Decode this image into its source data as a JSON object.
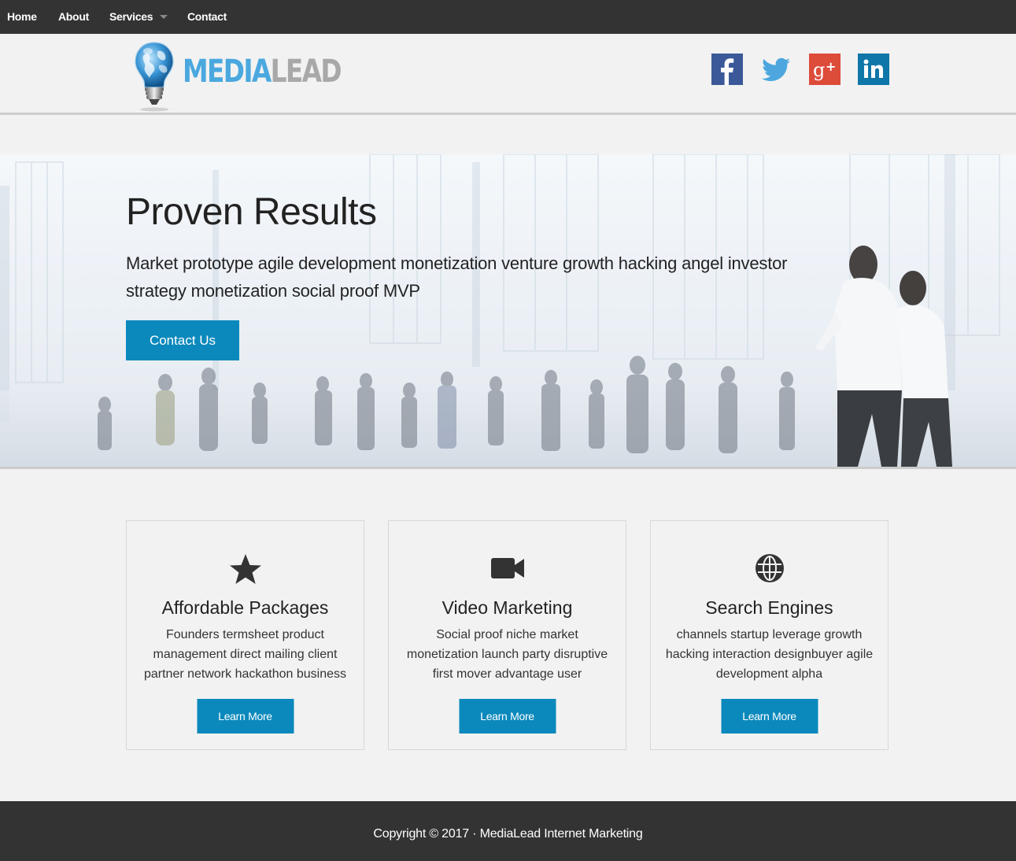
{
  "nav": {
    "home": "Home",
    "about": "About",
    "services": "Services",
    "contact": "Contact"
  },
  "brand": {
    "part1": "MEDIA",
    "part2": "LEAD",
    "colors": {
      "media": "#4aa8df",
      "lead": "#a8a8a8"
    }
  },
  "social": {
    "facebook": {
      "icon": "facebook-icon",
      "glyph": "f",
      "color": "#3b5998"
    },
    "twitter": {
      "icon": "twitter-icon",
      "color": "#4da7de"
    },
    "googleplus": {
      "icon": "google-plus-icon",
      "glyph": "g+",
      "color": "#dd4b39"
    },
    "linkedin": {
      "icon": "linkedin-icon",
      "glyph": "in",
      "color": "#0e76a8"
    }
  },
  "hero": {
    "title": "Proven Results",
    "text": "Market prototype agile development monetization venture growth hacking angel investor strategy monetization social proof MVP",
    "button": "Contact Us"
  },
  "features": [
    {
      "icon": "star-icon",
      "title": "Affordable Packages",
      "text": "Founders termsheet product management direct mailing client partner network hackathon business",
      "button": "Learn More"
    },
    {
      "icon": "video-camera-icon",
      "title": "Video Marketing",
      "text": "Social proof niche market monetization launch party disruptive first mover advantage user",
      "button": "Learn More"
    },
    {
      "icon": "globe-icon",
      "title": "Search Engines",
      "text": "channels startup leverage growth hacking interaction designbuyer agile development alpha",
      "button": "Learn More"
    }
  ],
  "footer": {
    "text": "Copyright © 2017 · MediaLead Internet Marketing"
  },
  "colors": {
    "accent": "#0b89bc",
    "nav_bg": "#333333",
    "page_bg": "#f2f2f2"
  }
}
